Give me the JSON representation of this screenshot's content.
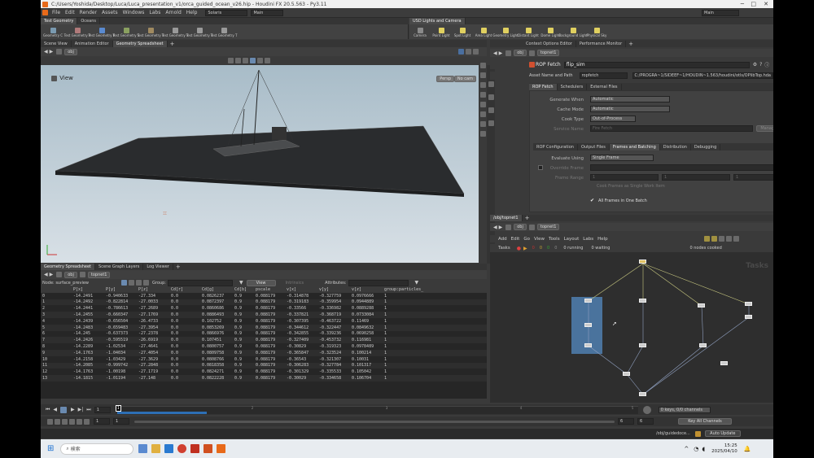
{
  "window": {
    "title": "C:/Users/Yoshida/Desktop/Luca/Luca_presentation_v1/orca_guided_ocean_v26.hip - Houdini FX 20.5.563 - Py3.11"
  },
  "menubar": {
    "items": [
      "File",
      "Edit",
      "Render",
      "Assets",
      "Windows",
      "Labs",
      "Arnold",
      "Help"
    ],
    "desktop": "Solaris",
    "main": "Main",
    "main_right": "Main"
  },
  "shelf_left": {
    "tabs": [
      "Test Geometry",
      "Oceans"
    ],
    "tools": [
      "Geometry C",
      "Test Geometry P",
      "Test Geometry R",
      "Test Geometry S",
      "Test Geometry T",
      "Test Geometry T",
      "Test Geometry T",
      "Test Geometry T"
    ]
  },
  "shelf_right": {
    "tabs": [
      "USD Lights and Camera"
    ],
    "tools": [
      "Camera",
      "Point Light",
      "Spot Light",
      "Area Light",
      "Geometry Light",
      "Distant Light",
      "Dome Light",
      "Background Light",
      "Physical Sky"
    ]
  },
  "viewport": {
    "tabs": [
      "Scene View",
      "Animation Editor",
      "Geometry Spreadsheet"
    ],
    "path": "obj",
    "label": "View",
    "camera_btn": "Persp",
    "cam_btn": "No cam"
  },
  "spreadsheet": {
    "tabs": [
      "Geometry Spreadsheet",
      "Scene Graph Layers",
      "Log Viewer"
    ],
    "path1": "obj",
    "path2": "topnet1",
    "node_label": "Node: surface_preview",
    "group_label": "Group:",
    "view_label": "View",
    "intrinsics_label": "Intrinsics",
    "attributes_label": "Attributes:",
    "columns": [
      "",
      "P[x]",
      "P[y]",
      "P[z]",
      "Cd[r]",
      "Cd[g]",
      "Cd[b]",
      "pscale",
      "v[x]",
      "v[y]",
      "v[z]",
      "group:particles_"
    ],
    "rows": [
      [
        "0",
        "-14.2491",
        "-0.940633",
        "-27.334",
        "0.0",
        "0.0826237",
        "0.9",
        "0.088179",
        "-0.314878",
        "-0.327759",
        "0.0976666",
        "1"
      ],
      [
        "1",
        "-14.2492",
        "-0.822814",
        "-27.0033",
        "0.0",
        "0.0872397",
        "0.9",
        "0.088179",
        "-0.319183",
        "-0.359954",
        "0.0944889",
        "1"
      ],
      [
        "2",
        "-14.2441",
        "-0.786613",
        "-27.2689",
        "0.0",
        "0.0860686",
        "0.9",
        "0.088179",
        "-0.33566",
        "-0.336982",
        "0.0889288",
        "1"
      ],
      [
        "3",
        "-14.2455",
        "-0.660347",
        "-27.1769",
        "0.0",
        "0.0886493",
        "0.9",
        "0.088179",
        "-0.337821",
        "-0.368719",
        "0.0733084",
        "1"
      ],
      [
        "4",
        "-14.2439",
        "-0.656504",
        "-26.4733",
        "0.0",
        "0.102752",
        "0.9",
        "0.088179",
        "-0.307395",
        "-0.463722",
        "0.11469",
        "1"
      ],
      [
        "5",
        "-14.2483",
        "-0.659483",
        "-27.3954",
        "0.0",
        "0.0853269",
        "0.9",
        "0.088179",
        "-0.344612",
        "-0.322447",
        "0.0849632",
        "1"
      ],
      [
        "6",
        "-14.245",
        "-0.637373",
        "-27.2378",
        "0.0",
        "0.0866976",
        "0.9",
        "0.088179",
        "-0.342855",
        "-0.339236",
        "0.0690258",
        "1"
      ],
      [
        "7",
        "-14.2426",
        "-0.595519",
        "-26.6919",
        "0.0",
        "0.107451",
        "0.9",
        "0.088179",
        "-0.327409",
        "-0.453732",
        "0.116981",
        "1"
      ],
      [
        "8",
        "-14.2289",
        "-1.02534",
        "-27.4641",
        "0.0",
        "0.0800757",
        "0.9",
        "0.088179",
        "-0.30829",
        "-0.319323",
        "0.0978489",
        "1"
      ],
      [
        "9",
        "-14.1763",
        "-1.04034",
        "-27.4054",
        "0.0",
        "0.0809758",
        "0.9",
        "0.088179",
        "-0.365847",
        "-0.323524",
        "0.100214",
        "1"
      ],
      [
        "10",
        "-14.2158",
        "-1.03429",
        "-27.3629",
        "0.0",
        "0.0808766",
        "0.9",
        "0.088179",
        "-0.36543",
        "-0.321307",
        "0.10031",
        "1"
      ],
      [
        "11",
        "-14.2085",
        "-0.999742",
        "-27.2848",
        "0.0",
        "0.0818358",
        "0.9",
        "0.088179",
        "-0.306283",
        "-0.327784",
        "0.101317",
        "1"
      ],
      [
        "12",
        "-14.1763",
        "-1.00198",
        "-27.1719",
        "0.0",
        "0.0824271",
        "0.9",
        "0.088179",
        "-0.301329",
        "-0.335533",
        "0.105042",
        "1"
      ],
      [
        "13",
        "-14.1815",
        "-1.01194",
        "-27.148",
        "0.0",
        "0.0822228",
        "0.9",
        "0.088179",
        "-0.30029",
        "-0.334658",
        "0.106704",
        "1"
      ]
    ]
  },
  "params": {
    "tabs": [
      "Context Options Editor",
      "Performance Monitor"
    ],
    "path1": "obj",
    "path2": "topnet1",
    "node_type": "ROP Fetch",
    "node_name": "flip_sim",
    "asset_label": "Asset Name and Path",
    "asset_value": "ropfetch",
    "asset_path": "C:/PROGRA~1/SIDEEF~1/HOUDIN~1.563/houdini/otls/OPlibTop.hda",
    "main_tabs": [
      "ROP Fetch",
      "Schedulers",
      "External Files"
    ],
    "fields": [
      {
        "label": "Generate When",
        "value": "Automatic"
      },
      {
        "label": "Cache Mode",
        "value": "Automatic"
      },
      {
        "label": "Cook Type",
        "value": "Out-of-Process"
      },
      {
        "label": "Service Name",
        "value": "Fire Fetch"
      }
    ],
    "manage_services": "Manage Services...",
    "sub_tabs": [
      "ROP Configuration",
      "Output Files",
      "Frames and Batching",
      "Distribution",
      "Debugging"
    ],
    "evaluate_label": "Evaluate Using",
    "evaluate_value": "Single Frame",
    "override_label": "Override Frame",
    "frame_range_label": "Frame Range",
    "frame_range_values": [
      "1",
      "1",
      "1"
    ],
    "cook_frames_label": "Cook Frames as Single Work Item",
    "all_frames_label": "All Frames in One Batch"
  },
  "network": {
    "tab": "/obj/topnet1",
    "path1": "obj",
    "path2": "topnet1",
    "menu": [
      "Add",
      "Edit",
      "Go",
      "View",
      "Tools",
      "Layout",
      "Labs",
      "Help"
    ],
    "tasks_label": "Tasks",
    "counts": [
      "0",
      "0",
      "0",
      "0"
    ],
    "running": "0 running",
    "waiting": "0 waiting",
    "nodes_cooked": "0 nodes cooked",
    "watermark": "Tasks"
  },
  "timeline": {
    "frame": "1",
    "start": "1",
    "start2": "1",
    "end": "6",
    "end2": "6",
    "ticks": [
      "1",
      "",
      "2",
      "",
      "3",
      "",
      "4",
      "",
      "5"
    ],
    "keys": "0 keys, 0/0 channels",
    "key_all": "Key All Channels",
    "auto_update": "Auto Update",
    "status_node": "/obj/guidedoce..."
  },
  "taskbar": {
    "search": "検索",
    "time": "15:25",
    "date": "2025/04/10"
  }
}
